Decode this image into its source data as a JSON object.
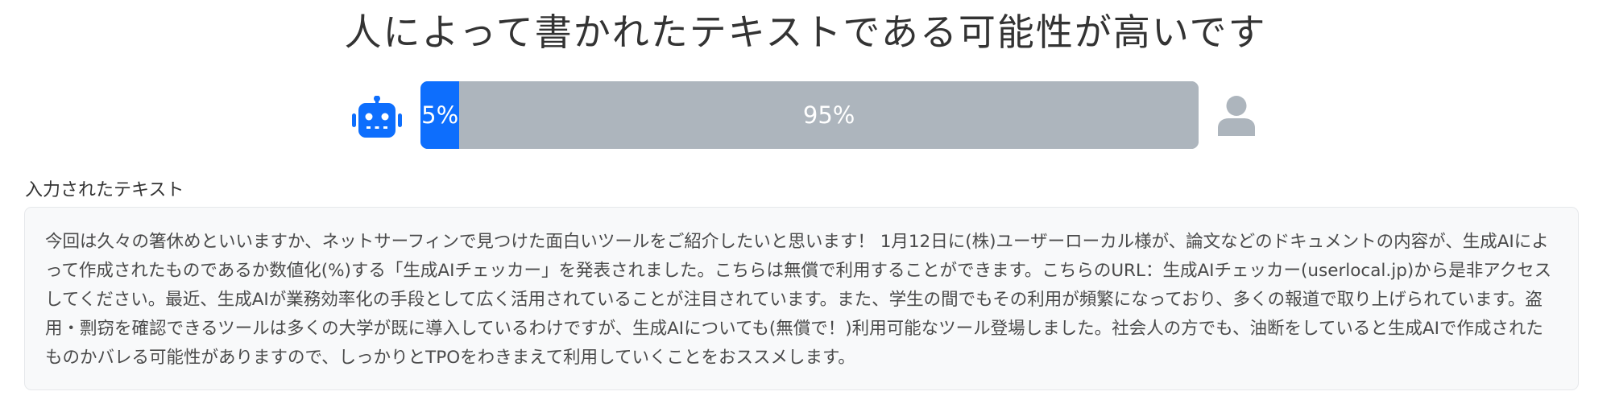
{
  "result": {
    "title": "人によって書かれたテキストである可能性が高いです"
  },
  "meter": {
    "ai_percent": 5,
    "human_percent": 95,
    "ai_label": "5%",
    "human_label": "95%",
    "ai_color": "#0d6efd",
    "human_color": "#adb5bd",
    "left_icon": "robot-icon",
    "right_icon": "user-icon"
  },
  "input": {
    "label": "入力されたテキスト",
    "text": "今回は久々の箸休めといいますか、ネットサーフィンで見つけた面白いツールをご紹介したいと思います！ 1月12日に(株)ユーザーローカル様が、論文などのドキュメントの内容が、生成AIによって作成されたものであるか数値化(%)する「生成AIチェッカー」を発表されました。こちらは無償で利用することができます。こちらのURL：生成AIチェッカー(userlocal.jp)から是非アクセスしてください。最近、生成AIが業務効率化の手段として広く活用されていることが注目されています。また、学生の間でもその利用が頻繁になっており、多くの報道で取り上げられています。盗用・剽窃を確認できるツールは多くの大学が既に導入しているわけですが、生成AIについても(無償で！)利用可能なツール登場しました。社会人の方でも、油断をしていると生成AIで作成されたものかバレる可能性がありますので、しっかりとTPOをわきまえて利用していくことをおススメします。"
  }
}
